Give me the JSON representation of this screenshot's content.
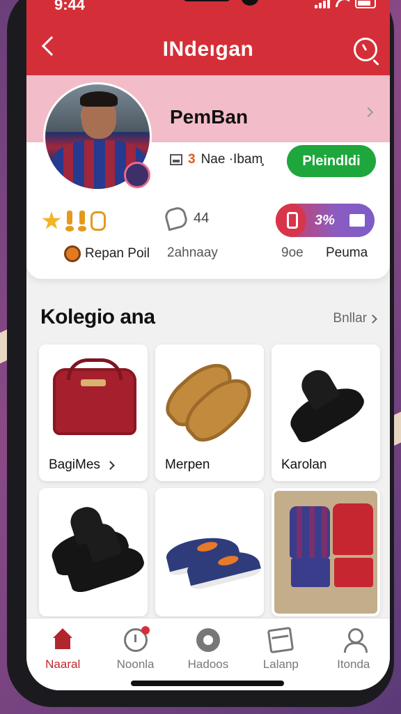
{
  "status": {
    "time": "9:44"
  },
  "header": {
    "title": "INdeıgan"
  },
  "profile": {
    "name": "PemBan",
    "rank_number": "3",
    "rank_text": "Nae ·Ibam̧",
    "follow_label": "Pleindldi",
    "chat_count": "44",
    "progress_label": "3%",
    "progress_value": 0.3,
    "labels": {
      "pool": "Repan Poil",
      "summary": "2ahnaay",
      "score": "9oe",
      "points": "Peuma"
    }
  },
  "section": {
    "title": "Kolegio ana",
    "see_all": "Bnllar"
  },
  "products": [
    {
      "label": "BagiMes",
      "has_chevron": true,
      "icon": "bag"
    },
    {
      "label": "Merpen",
      "has_chevron": false,
      "icon": "insoles"
    },
    {
      "label": "Karolan",
      "has_chevron": false,
      "icon": "cleat"
    },
    {
      "label": "",
      "has_chevron": false,
      "icon": "boots"
    },
    {
      "label": "",
      "has_chevron": false,
      "icon": "sneakers"
    },
    {
      "label": "",
      "has_chevron": false,
      "icon": "kits"
    }
  ],
  "bottom_nav": [
    {
      "label": "Naaral",
      "icon": "home-icon",
      "active": true
    },
    {
      "label": "Noonla",
      "icon": "clock-icon",
      "active": false
    },
    {
      "label": "Hadoos",
      "icon": "ball-icon",
      "active": false
    },
    {
      "label": "Lalanp",
      "icon": "box-icon",
      "active": false
    },
    {
      "label": "Itonda",
      "icon": "user-icon",
      "active": false
    }
  ],
  "colors": {
    "header": "#d42f38",
    "accent_green": "#1ea73c",
    "band_pink": "#f3bcc9"
  }
}
